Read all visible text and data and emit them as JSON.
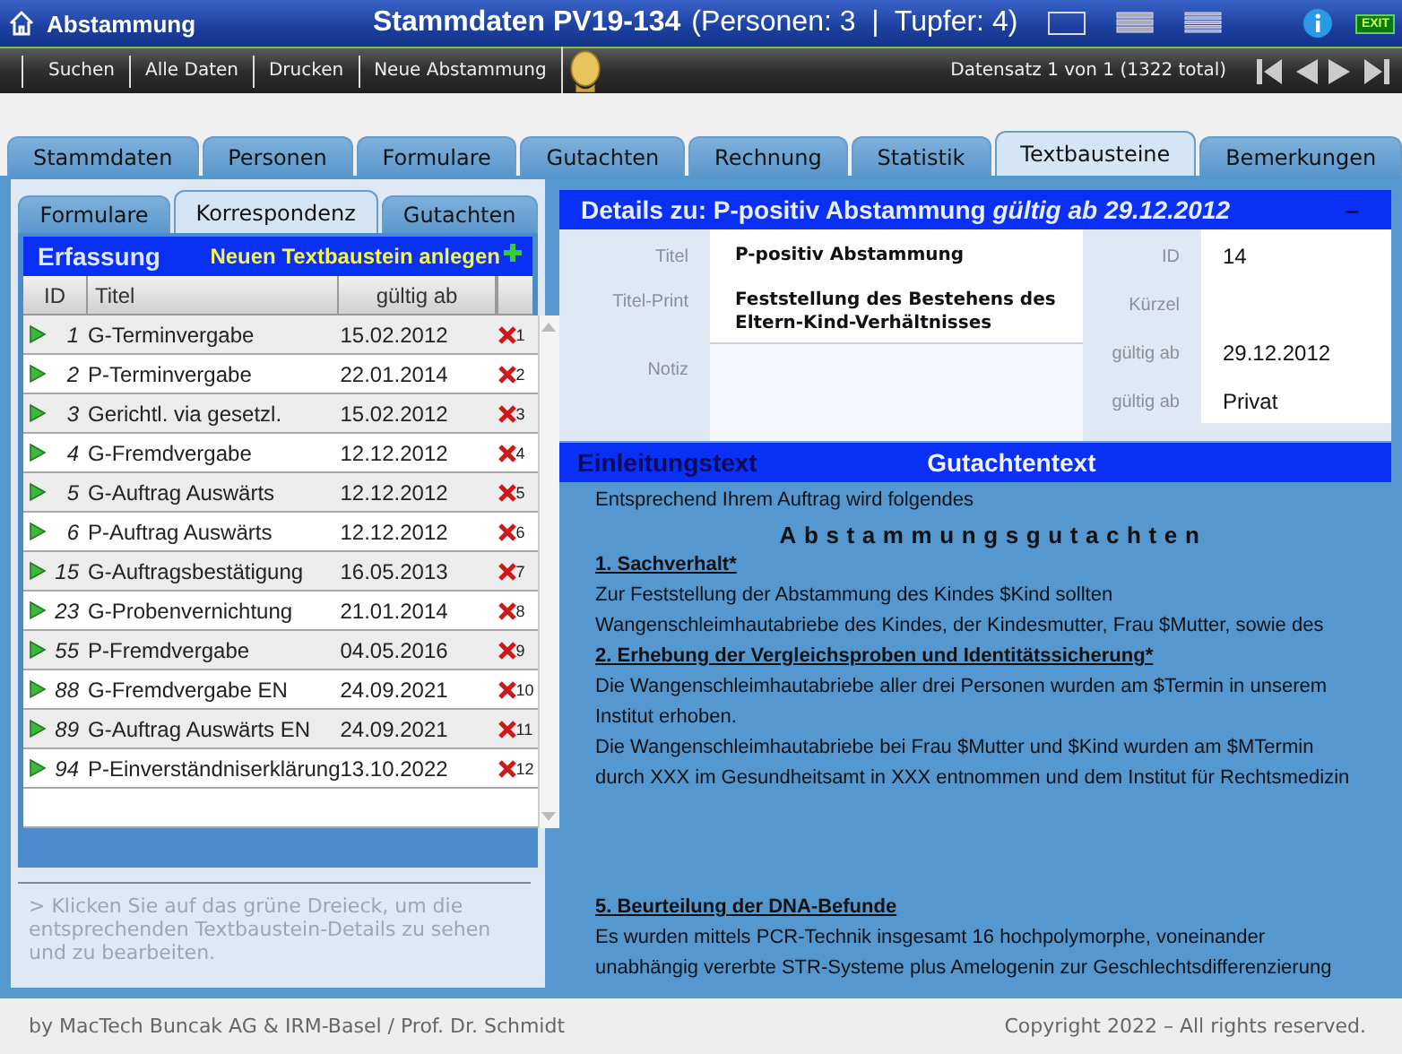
{
  "window": {
    "title": "Abstammung",
    "record": "Stammdaten PV19-134",
    "counts": "(Personen: 3  |  Tupfer: 4)",
    "exit": "EXIT"
  },
  "toolbar": {
    "buttons": [
      "Suchen",
      "Alle Daten",
      "Drucken",
      "Neue Abstammung"
    ],
    "record_status": "Datensatz 1 von 1 (1322 total)"
  },
  "main_tabs": [
    {
      "label": "Stammdaten",
      "selected": false
    },
    {
      "label": "Personen",
      "selected": false
    },
    {
      "label": "Formulare",
      "selected": false
    },
    {
      "label": "Gutachten",
      "selected": false
    },
    {
      "label": "Rechnung",
      "selected": false
    },
    {
      "label": "Statistik",
      "selected": false
    },
    {
      "label": "Textbausteine",
      "selected": true
    },
    {
      "label": "Bemerkungen",
      "selected": false
    }
  ],
  "sub_tabs": [
    {
      "label": "Formulare",
      "selected": false
    },
    {
      "label": "Korrespondenz",
      "selected": true
    },
    {
      "label": "Gutachten",
      "selected": false
    }
  ],
  "list": {
    "title": "Erfassung",
    "new_link": "Neuen Textbaustein anlegen",
    "columns": [
      "ID",
      "Titel",
      "gültig ab"
    ],
    "rows": [
      {
        "id": "1",
        "title": "G-Terminvergabe",
        "date": "15.02.2012",
        "index": "1"
      },
      {
        "id": "2",
        "title": "P-Terminvergabe",
        "date": "22.01.2014",
        "index": "2"
      },
      {
        "id": "3",
        "title": "Gerichtl. via gesetzl.",
        "date": "15.02.2012",
        "index": "3"
      },
      {
        "id": "4",
        "title": "G-Fremdvergabe",
        "date": "12.12.2012",
        "index": "4"
      },
      {
        "id": "5",
        "title": "G-Auftrag Auswärts",
        "date": "12.12.2012",
        "index": "5"
      },
      {
        "id": "6",
        "title": "P-Auftrag Auswärts",
        "date": "12.12.2012",
        "index": "6"
      },
      {
        "id": "15",
        "title": "G-Auftragsbestätigung",
        "date": "16.05.2013",
        "index": "7"
      },
      {
        "id": "23",
        "title": "G-Probenvernichtung",
        "date": "21.01.2014",
        "index": "8"
      },
      {
        "id": "55",
        "title": "P-Fremdvergabe",
        "date": "04.05.2016",
        "index": "9"
      },
      {
        "id": "88",
        "title": "G-Fremdvergabe EN",
        "date": "24.09.2021",
        "index": "10"
      },
      {
        "id": "89",
        "title": "G-Auftrag Auswärts EN",
        "date": "24.09.2021",
        "index": "11"
      },
      {
        "id": "94",
        "title": "P-Einverständniserklärung",
        "date": "13.10.2022",
        "index": "12"
      }
    ]
  },
  "hint": "> Klicken Sie auf das grüne Dreieck, um die entsprechenden Textbaustein-Details zu sehen und zu bearbeiten.",
  "details": {
    "header": "Details zu: P-positiv Abstammung *gültig ab 29.12.2012*",
    "collapse": "–",
    "left_fields": [
      {
        "kind": "line",
        "label": "Titel",
        "value": "P-positiv Abstammung"
      },
      {
        "kind": "line",
        "label": "Titel-Print",
        "value": "Feststellung des Bestehens des Eltern-Kind-Verhältnisses"
      },
      {
        "kind": "note",
        "label": "Notiz"
      }
    ],
    "right_fields": [
      {
        "label": "ID",
        "value": "14"
      },
      {
        "label": "Kürzel"
      },
      {
        "label": "gültig ab",
        "value": "29.12.2012"
      },
      {
        "label": "gültig ab",
        "value": "Privat"
      }
    ]
  },
  "text_tabs": [
    {
      "label": "Einleitungstext",
      "selected": false
    },
    {
      "label": "Gutachtentext",
      "selected": true
    }
  ],
  "body": {
    "upper": [
      {
        "kind": "text",
        "text": "Entsprechend Ihrem Auftrag wird folgendes"
      },
      {
        "kind": "title",
        "text": "Abstammungsgutachten"
      },
      {
        "kind": "heading",
        "text": "1. Sachverhalt*"
      },
      {
        "kind": "text",
        "text": "Zur Feststellung der Abstammung des Kindes $Kind sollten"
      },
      {
        "kind": "text",
        "text": "Wangenschleimhautabriebe des Kindes, der Kindesmutter, Frau $Mutter, sowie des"
      },
      {
        "kind": "heading",
        "text": "2. Erhebung der Vergleichsproben und Identitätssicherung*"
      },
      {
        "kind": "text",
        "text": "Die Wangenschleimhautabriebe aller drei Personen wurden am $Termin in unserem"
      },
      {
        "kind": "text",
        "text": "Institut erhoben."
      },
      {
        "kind": "text",
        "text": "Die Wangenschleimhautabriebe bei Frau $Mutter und $Kind wurden am $MTermin"
      },
      {
        "kind": "text",
        "text": "durch XXX im Gesundheitsamt in XXX entnommen und dem Institut für Rechtsmedizin"
      }
    ],
    "lower": [
      {
        "kind": "heading",
        "text": "5. Beurteilung der DNA-Befunde"
      },
      {
        "kind": "text",
        "text": "Es wurden mittels PCR-Technik insgesamt 16 hochpolymorphe, voneinander"
      },
      {
        "kind": "text",
        "text": "unabhängig vererbte STR-Systeme plus Amelogenin zur Geschlechtsdifferenzierung"
      }
    ]
  },
  "footer": {
    "left": "by MacTech Buncak AG & IRM-Basel / Prof. Dr. Schmidt",
    "right": "Copyright 2022 – All rights reserved."
  }
}
